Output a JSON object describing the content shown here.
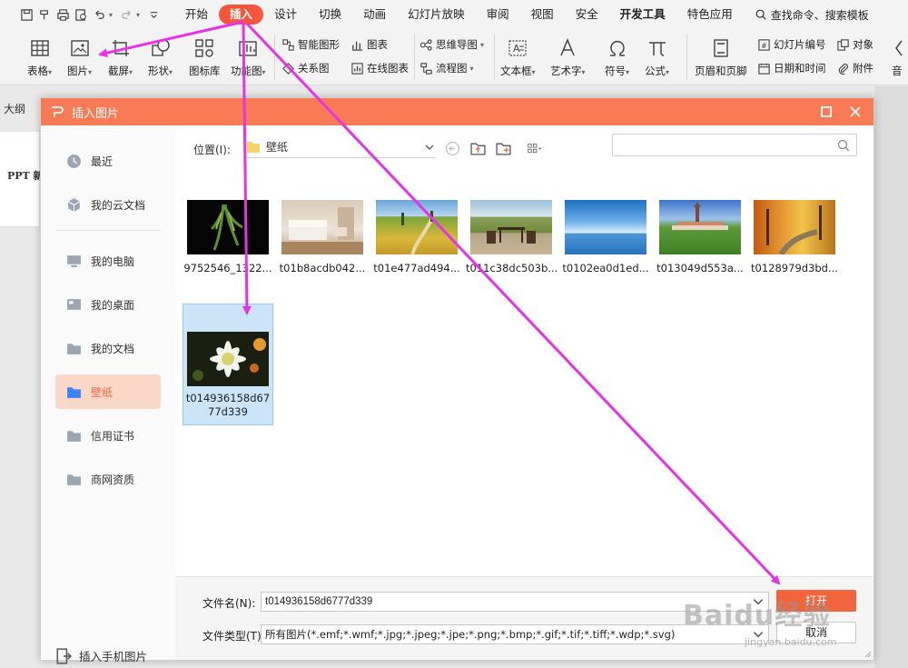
{
  "ribbon": {
    "tabs": [
      "开始",
      "插入",
      "设计",
      "切换",
      "动画",
      "幻灯片放映",
      "审阅",
      "视图",
      "安全",
      "开发工具",
      "特色应用"
    ],
    "active_tab": "插入",
    "search_label": "查找命令、搜索模板"
  },
  "toolbar": {
    "table": "表格",
    "picture": "图片",
    "screenshot": "截屏",
    "shape": "形状",
    "icons": "图标库",
    "function_chart": "功能图",
    "smart_graphic": "智能图形",
    "chart": "图表",
    "relation_chart": "关系图",
    "online_chart": "在线图表",
    "mind_map": "思维导图",
    "flow_chart": "流程图",
    "text_box": "文本框",
    "art_text": "艺术字",
    "symbol": "符号",
    "formula": "公式",
    "header_footer": "页眉和页脚",
    "slide_number": "幻灯片编号",
    "object": "对象",
    "date_time": "日期和时间",
    "attachment": "附件",
    "audio": "音"
  },
  "doc": {
    "outline_tab": "大纲",
    "slide_text": "PPT 新"
  },
  "dialog": {
    "title": "插入图片",
    "sidebar": [
      {
        "label": "最近"
      },
      {
        "label": "我的云文档"
      },
      {
        "label": "我的电脑"
      },
      {
        "label": "我的桌面"
      },
      {
        "label": "我的文档"
      },
      {
        "label": "壁纸"
      },
      {
        "label": "信用证书"
      },
      {
        "label": "商网资质"
      }
    ],
    "phone_import": "插入手机图片",
    "location_label": "位置(I):",
    "location_value": "壁纸",
    "search_placeholder": "",
    "files": [
      {
        "name": "9752546_1322..."
      },
      {
        "name": "t01b8acdb042..."
      },
      {
        "name": "t01e477ad494..."
      },
      {
        "name": "t011c38dc503b..."
      },
      {
        "name": "t0102ea0d1ed..."
      },
      {
        "name": "t013049d553a..."
      },
      {
        "name": "t0128979d3bd..."
      },
      {
        "name": "t014936158d6777d339"
      }
    ],
    "filename_label": "文件名(N):",
    "filename_value": "t014936158d6777d339",
    "filetype_label": "文件类型(T):",
    "filetype_value": "所有图片(*.emf;*.wmf;*.jpg;*.jpeg;*.jpe;*.png;*.bmp;*.gif;*.tif;*.tiff;*.wdp;*.svg)",
    "open_button": "打开",
    "cancel_button": "取消"
  },
  "watermark": {
    "brand": "Baidu经验",
    "url": "jingyan.baidu.com"
  },
  "colors": {
    "accent": "#f4553b",
    "dialog_title": "#f87b55",
    "arrow": "#e633e6",
    "selection": "#cce4f7"
  }
}
